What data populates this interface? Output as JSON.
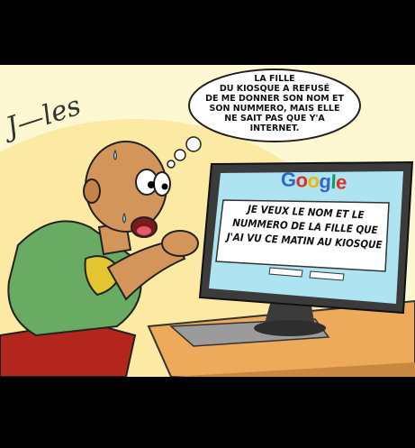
{
  "comic": {
    "thought_bubble": "LA FILLE\nDU KIOSQUE A REFUSÉ\nDE ME DONNER SON NOM ET\nSON NUMMERO, MAIS ELLE\nNE SAIT PAS QUE Y'A\nINTERNET.",
    "signature": "J—les",
    "screen": {
      "logo": "Google",
      "search_query": "JE VEUX LE NOM ET LE\nNUMMERO DE LA FILLE QUE\nJ'AI VU CE MATIN AU KIOSQUE"
    }
  },
  "colors": {
    "background": "#fdf7d2",
    "skin": "#d4955a",
    "shirt": "#6aab63",
    "trim": "#e2c531",
    "screen": "#ffffff",
    "monitor": "#3b3b3b",
    "desk": "#ecaa5a"
  }
}
